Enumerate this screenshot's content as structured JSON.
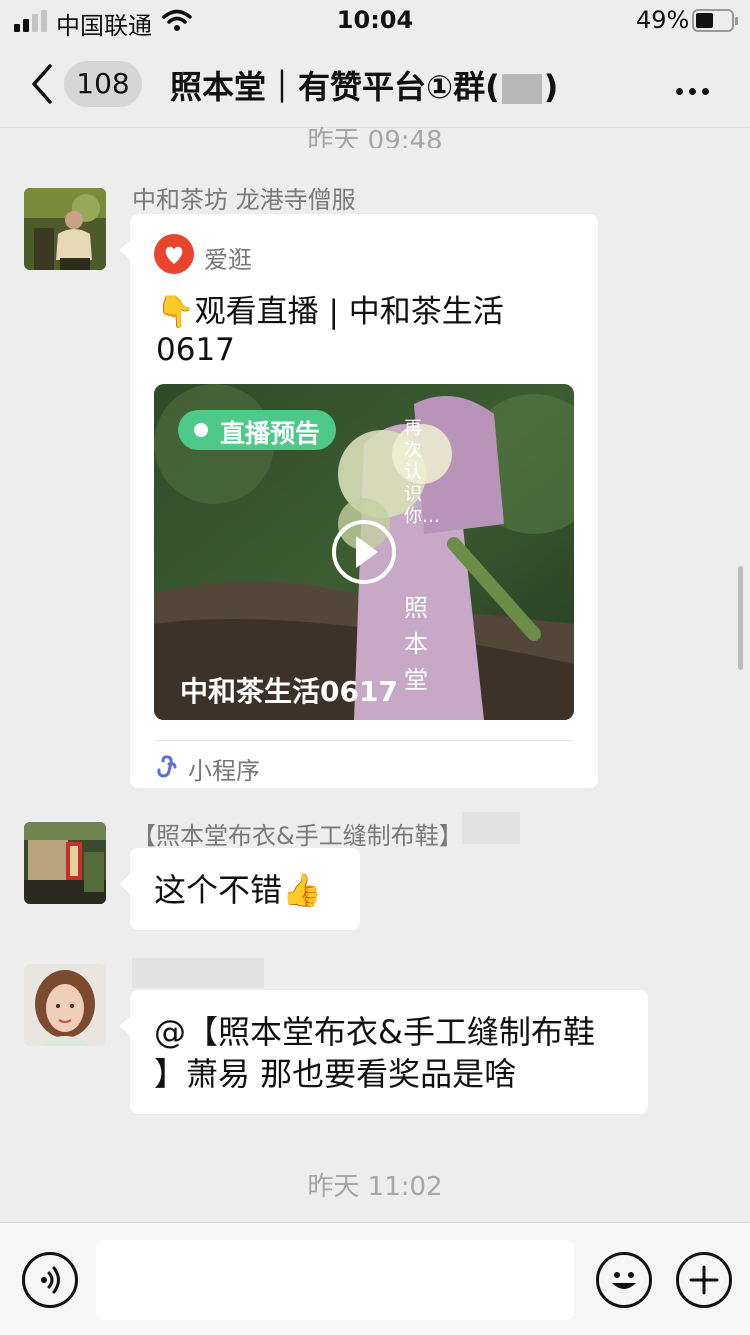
{
  "status_bar": {
    "carrier": "中国联通",
    "time": "10:04",
    "battery": "49%"
  },
  "header": {
    "unread_count": "108",
    "title_text": "照本堂｜有赞平台①群(",
    "title_close": ")"
  },
  "chat": {
    "timestamp_top": "昨天 09:48",
    "timestamp_bottom": "昨天 11:02",
    "messages": [
      {
        "sender": "中和茶坊 龙港寺僧服",
        "card": {
          "app_name": "爱逛",
          "title_line1": "👇观看直播 | 中和茶生活",
          "title_line2": "0617",
          "live_badge": "直播预告",
          "overlay_title": "中和茶生活0617",
          "vertical_text_1": "再次认识你…",
          "vertical_text_2": "照本堂",
          "footer_label": "小程序"
        }
      },
      {
        "sender": "【照本堂布衣&手工缝制布鞋】",
        "text": "这个不错👍"
      },
      {
        "sender": "",
        "text_line1": "@【照本堂布衣&手工缝制布鞋",
        "text_line2": "】萧易 那也要看奖品是啥"
      }
    ]
  },
  "colors": {
    "background": "#ededed",
    "live_badge": "#4fc98a",
    "app_icon": "#e8452c",
    "mini_program": "#5b6fd6"
  }
}
